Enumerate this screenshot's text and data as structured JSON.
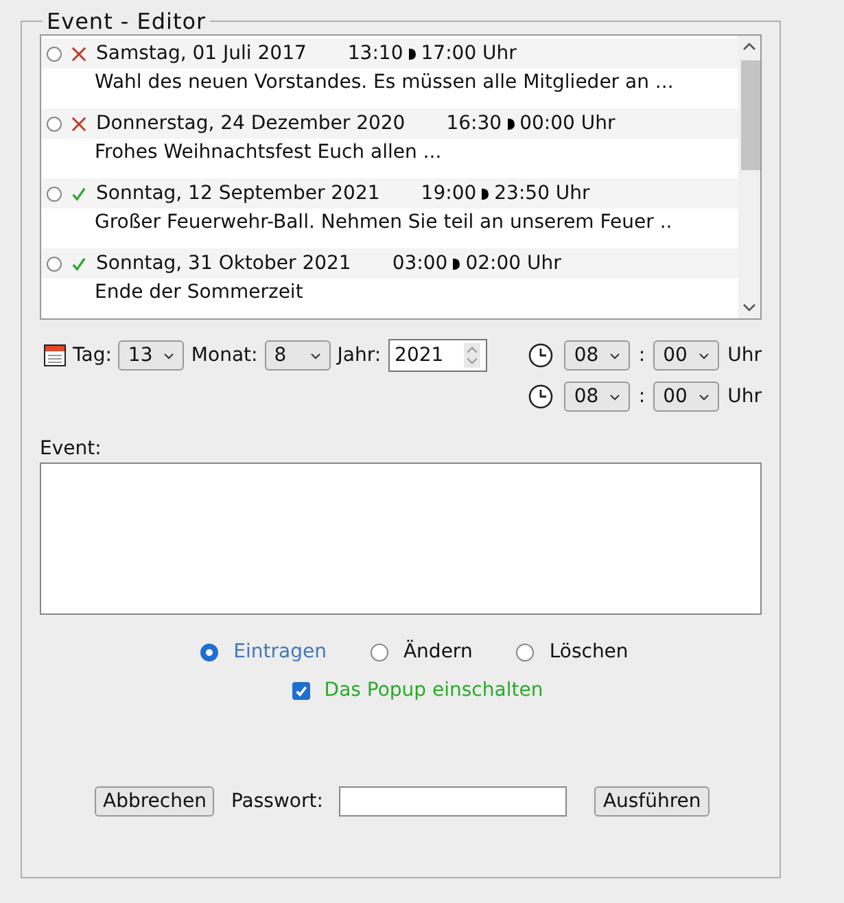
{
  "legend": "Event - Editor",
  "events": [
    {
      "selected": false,
      "kind": "cancelled",
      "date": "Samstag, 01 Juli 2017",
      "start": "13:10",
      "end": "17:00 Uhr",
      "text": "Wahl des neuen Vorstandes. Es müssen alle Mitglieder an ..."
    },
    {
      "selected": false,
      "kind": "cancelled",
      "date": "Donnerstag, 24 Dezember 2020",
      "start": "16:30",
      "end": "00:00 Uhr",
      "text": "Frohes Weihnachtsfest Euch allen ..."
    },
    {
      "selected": false,
      "kind": "confirmed",
      "date": "Sonntag, 12 September 2021",
      "start": "19:00",
      "end": "23:50 Uhr",
      "text": "Großer Feuerwehr-Ball. Nehmen Sie teil an unserem Feuer .."
    },
    {
      "selected": false,
      "kind": "confirmed",
      "date": "Sonntag, 31 Oktober 2021",
      "start": "03:00",
      "end": "02:00 Uhr",
      "text": "Ende der Sommerzeit"
    }
  ],
  "date": {
    "day_label": "Tag:",
    "day": "13",
    "month_label": "Monat:",
    "month": "8",
    "year_label": "Jahr:",
    "year": "2021"
  },
  "times": [
    {
      "hour": "08",
      "sep": ":",
      "minute": "00",
      "unit": "Uhr"
    },
    {
      "hour": "08",
      "sep": ":",
      "minute": "00",
      "unit": "Uhr"
    }
  ],
  "event_label": "Event:",
  "actions": [
    {
      "label": "Eintragen",
      "selected": true
    },
    {
      "label": "Ändern",
      "selected": false
    },
    {
      "label": "Löschen",
      "selected": false
    }
  ],
  "popup": {
    "label": "Das Popup einschalten",
    "checked": true
  },
  "cancel": "Abbrechen",
  "password_label": "Passwort:",
  "submit": "Ausführen"
}
